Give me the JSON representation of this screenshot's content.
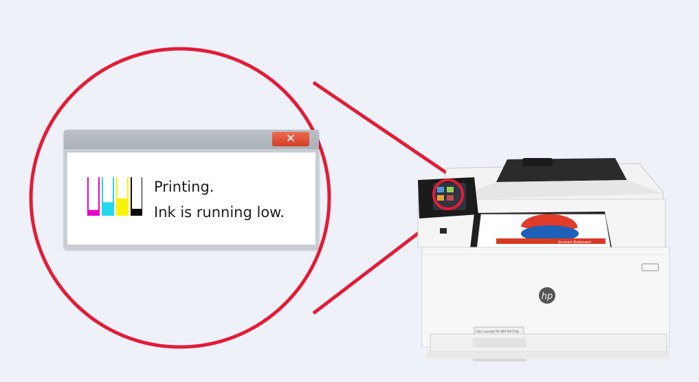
{
  "dialog": {
    "close_label": "✕",
    "status_text": "Printing.",
    "warning_text": "Ink is running low."
  },
  "ink_levels": [
    {
      "name": "magenta",
      "color": "#e600c8",
      "level": 0.15
    },
    {
      "name": "cyan",
      "color": "#22d6ee",
      "level": 0.35
    },
    {
      "name": "yellow",
      "color": "#fbf20a",
      "level": 0.45
    },
    {
      "name": "black",
      "color": "#0a0a0a",
      "level": 0.18
    }
  ],
  "colors": {
    "callout_ring": "#e41b37",
    "background": "#eef2f8",
    "close_button": "#e1502f"
  },
  "printer": {
    "logo_text": "hp",
    "model_label": "Color LaserJet Pro MFP M277dw",
    "brand_strip": "HEWLETT-PACKARD",
    "sheet_label": "Account Statement"
  }
}
